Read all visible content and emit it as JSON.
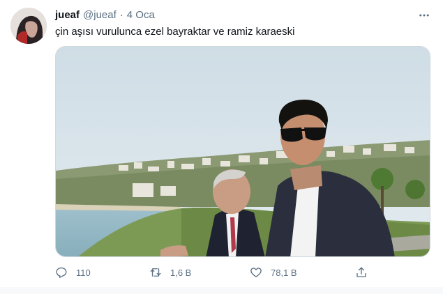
{
  "tweet": {
    "author_name": "jueaf",
    "author_handle": "@jueaf",
    "separator": "·",
    "date": "4 Oca",
    "text": "çin aşısı vurulunca ezel bayraktar ve ramiz karaeski"
  },
  "actions": {
    "reply_count": "110",
    "retweet_count": "1,6 B",
    "like_count": "78,1 B"
  },
  "icons": {
    "more": "more-icon",
    "reply": "reply-icon",
    "retweet": "retweet-icon",
    "like": "heart-icon",
    "share": "share-icon"
  },
  "colors": {
    "text": "#0f1419",
    "secondary": "#5b7083",
    "border": "#cfd9de"
  }
}
